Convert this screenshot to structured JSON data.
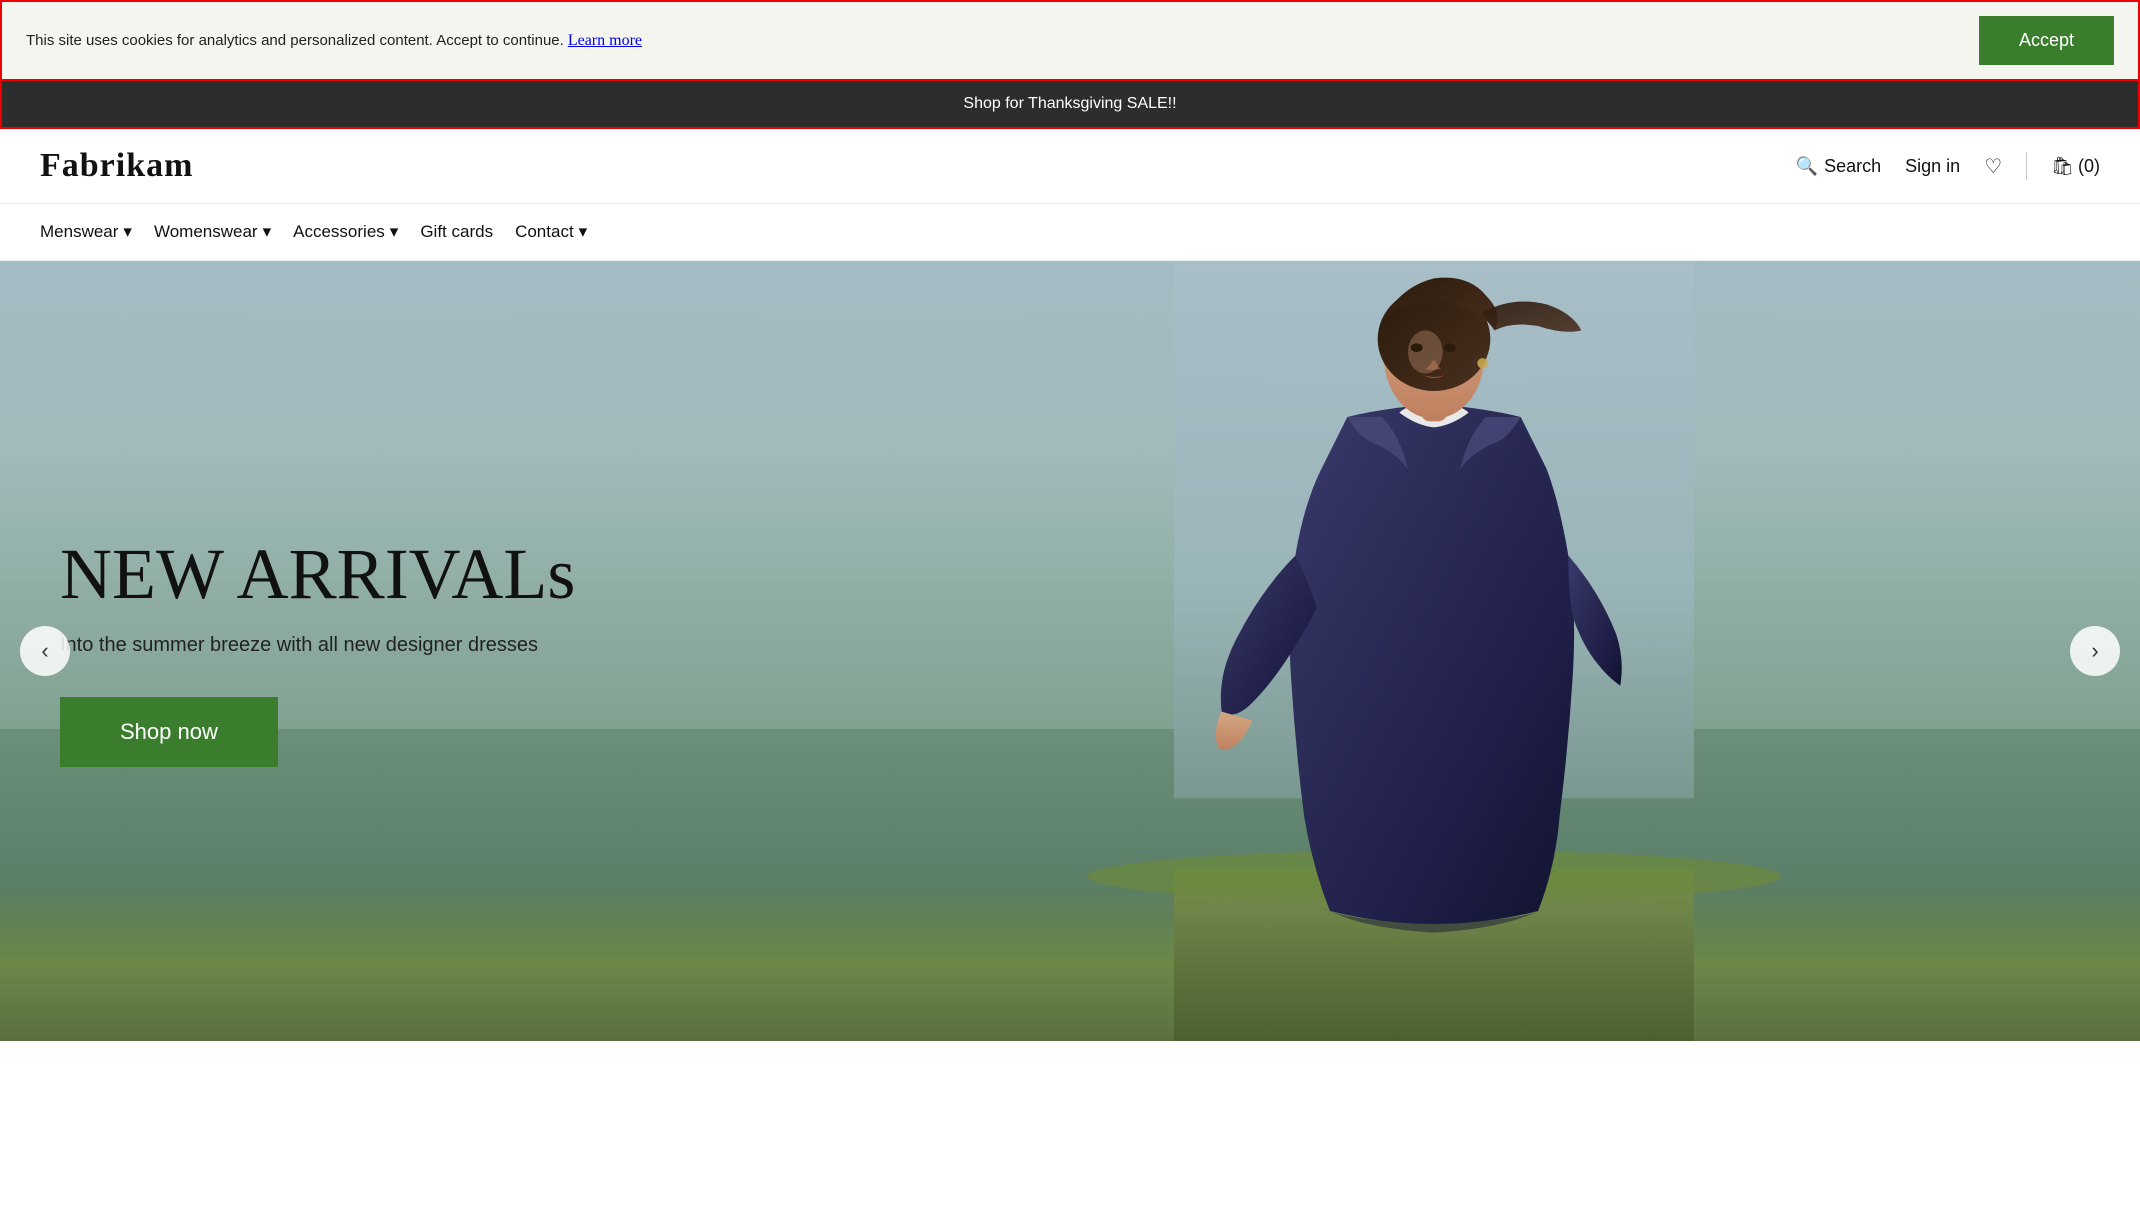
{
  "cookie": {
    "message": "This site uses cookies for analytics and personalized content. Accept to continue.",
    "learn_more_label": "Learn more",
    "accept_label": "Accept"
  },
  "sale_banner": {
    "text": "Shop for Thanksgiving SALE!!"
  },
  "header": {
    "logo": "Fabrikam",
    "search_label": "Search",
    "signin_label": "Sign in",
    "cart_label": "(0)"
  },
  "nav": {
    "items": [
      {
        "label": "Menswear",
        "has_dropdown": true
      },
      {
        "label": "Womenswear",
        "has_dropdown": true
      },
      {
        "label": "Accessories",
        "has_dropdown": true
      },
      {
        "label": "Gift cards",
        "has_dropdown": false
      },
      {
        "label": "Contact",
        "has_dropdown": true
      }
    ]
  },
  "hero": {
    "title": "NEW ARRIVALs",
    "subtitle": "Into the summer breeze with all new designer dresses",
    "cta_label": "Shop now",
    "prev_label": "‹",
    "next_label": "›"
  }
}
